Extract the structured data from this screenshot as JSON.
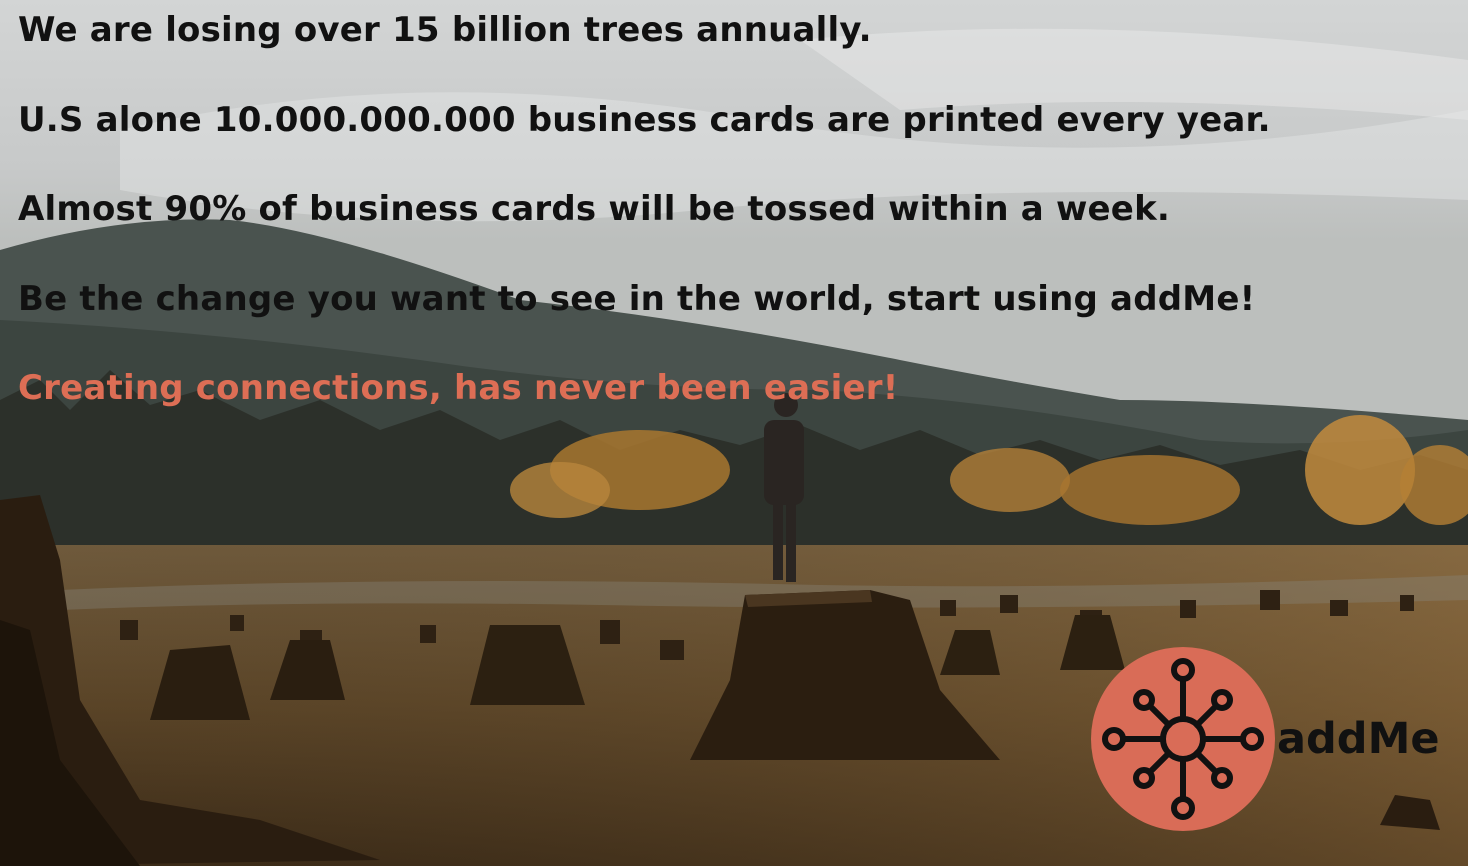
{
  "headline_lines": [
    "We are losing over 15 billion trees annually.",
    "U.S alone 10.000.000.000 business cards are printed every year.",
    "Almost 90% of business cards will be tossed within a week.",
    "Be the change you want to see in the world, start using addMe!"
  ],
  "tagline": "Creating connections, has never been easier!",
  "logo": {
    "name": "addMe",
    "icon": "network-node-icon"
  },
  "colors": {
    "accent": "#dd6e55",
    "text": "#111111",
    "logo_circle": "#d96c57"
  }
}
